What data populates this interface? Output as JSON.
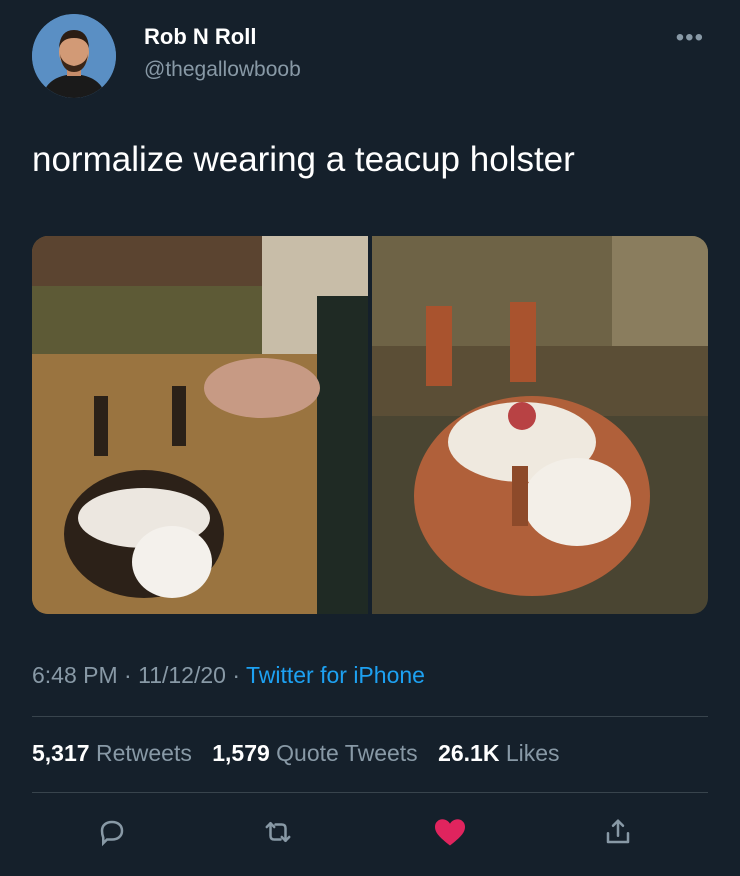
{
  "author": {
    "display_name": "Rob N Roll",
    "handle": "@thegallowboob"
  },
  "more_icon": "more-icon",
  "tweet": {
    "text": "normalize wearing a teacup holster"
  },
  "meta": {
    "time": "6:48 PM",
    "sep1": " · ",
    "date": "11/12/20",
    "sep2": " · ",
    "source": "Twitter for iPhone"
  },
  "stats": {
    "retweets_count": "5,317",
    "retweets_label": "Retweets",
    "quotes_count": "1,579",
    "quotes_label": "Quote Tweets",
    "likes_count": "26.1K",
    "likes_label": "Likes"
  },
  "actions": [
    {
      "icon": "reply-icon"
    },
    {
      "icon": "retweet-icon"
    },
    {
      "icon": "heart-icon",
      "color": "#e0245e"
    },
    {
      "icon": "share-icon"
    }
  ]
}
